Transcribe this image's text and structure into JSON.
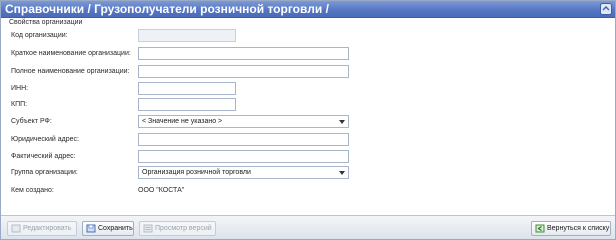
{
  "header": {
    "title": "Справочники / Грузополучатели розничной торговли /"
  },
  "form": {
    "section_label": "Свойства организации",
    "fields": {
      "code": {
        "label": "Код организации:",
        "value": ""
      },
      "short_name": {
        "label": "Краткое наименование организации:",
        "value": ""
      },
      "full_name": {
        "label": "Полное наименование организации:",
        "value": ""
      },
      "inn": {
        "label": "ИНН:",
        "value": ""
      },
      "kpp": {
        "label": "КПП:",
        "value": ""
      },
      "region": {
        "label": "Субъект РФ:",
        "value": "< Значение не указано >"
      },
      "legal_address": {
        "label": "Юридический адрес:",
        "value": ""
      },
      "actual_address": {
        "label": "Фактический адрес:",
        "value": ""
      },
      "org_group": {
        "label": "Группа организации:",
        "value": "Организация розничной торговли"
      },
      "created_by": {
        "label": "Кем создано:",
        "value": "ООО \"КОСТА\""
      }
    }
  },
  "toolbar": {
    "edit_label": "Редактировать",
    "save_label": "Сохранить",
    "versions_label": "Просмотр версий",
    "back_label": "Вернуться к списку"
  }
}
